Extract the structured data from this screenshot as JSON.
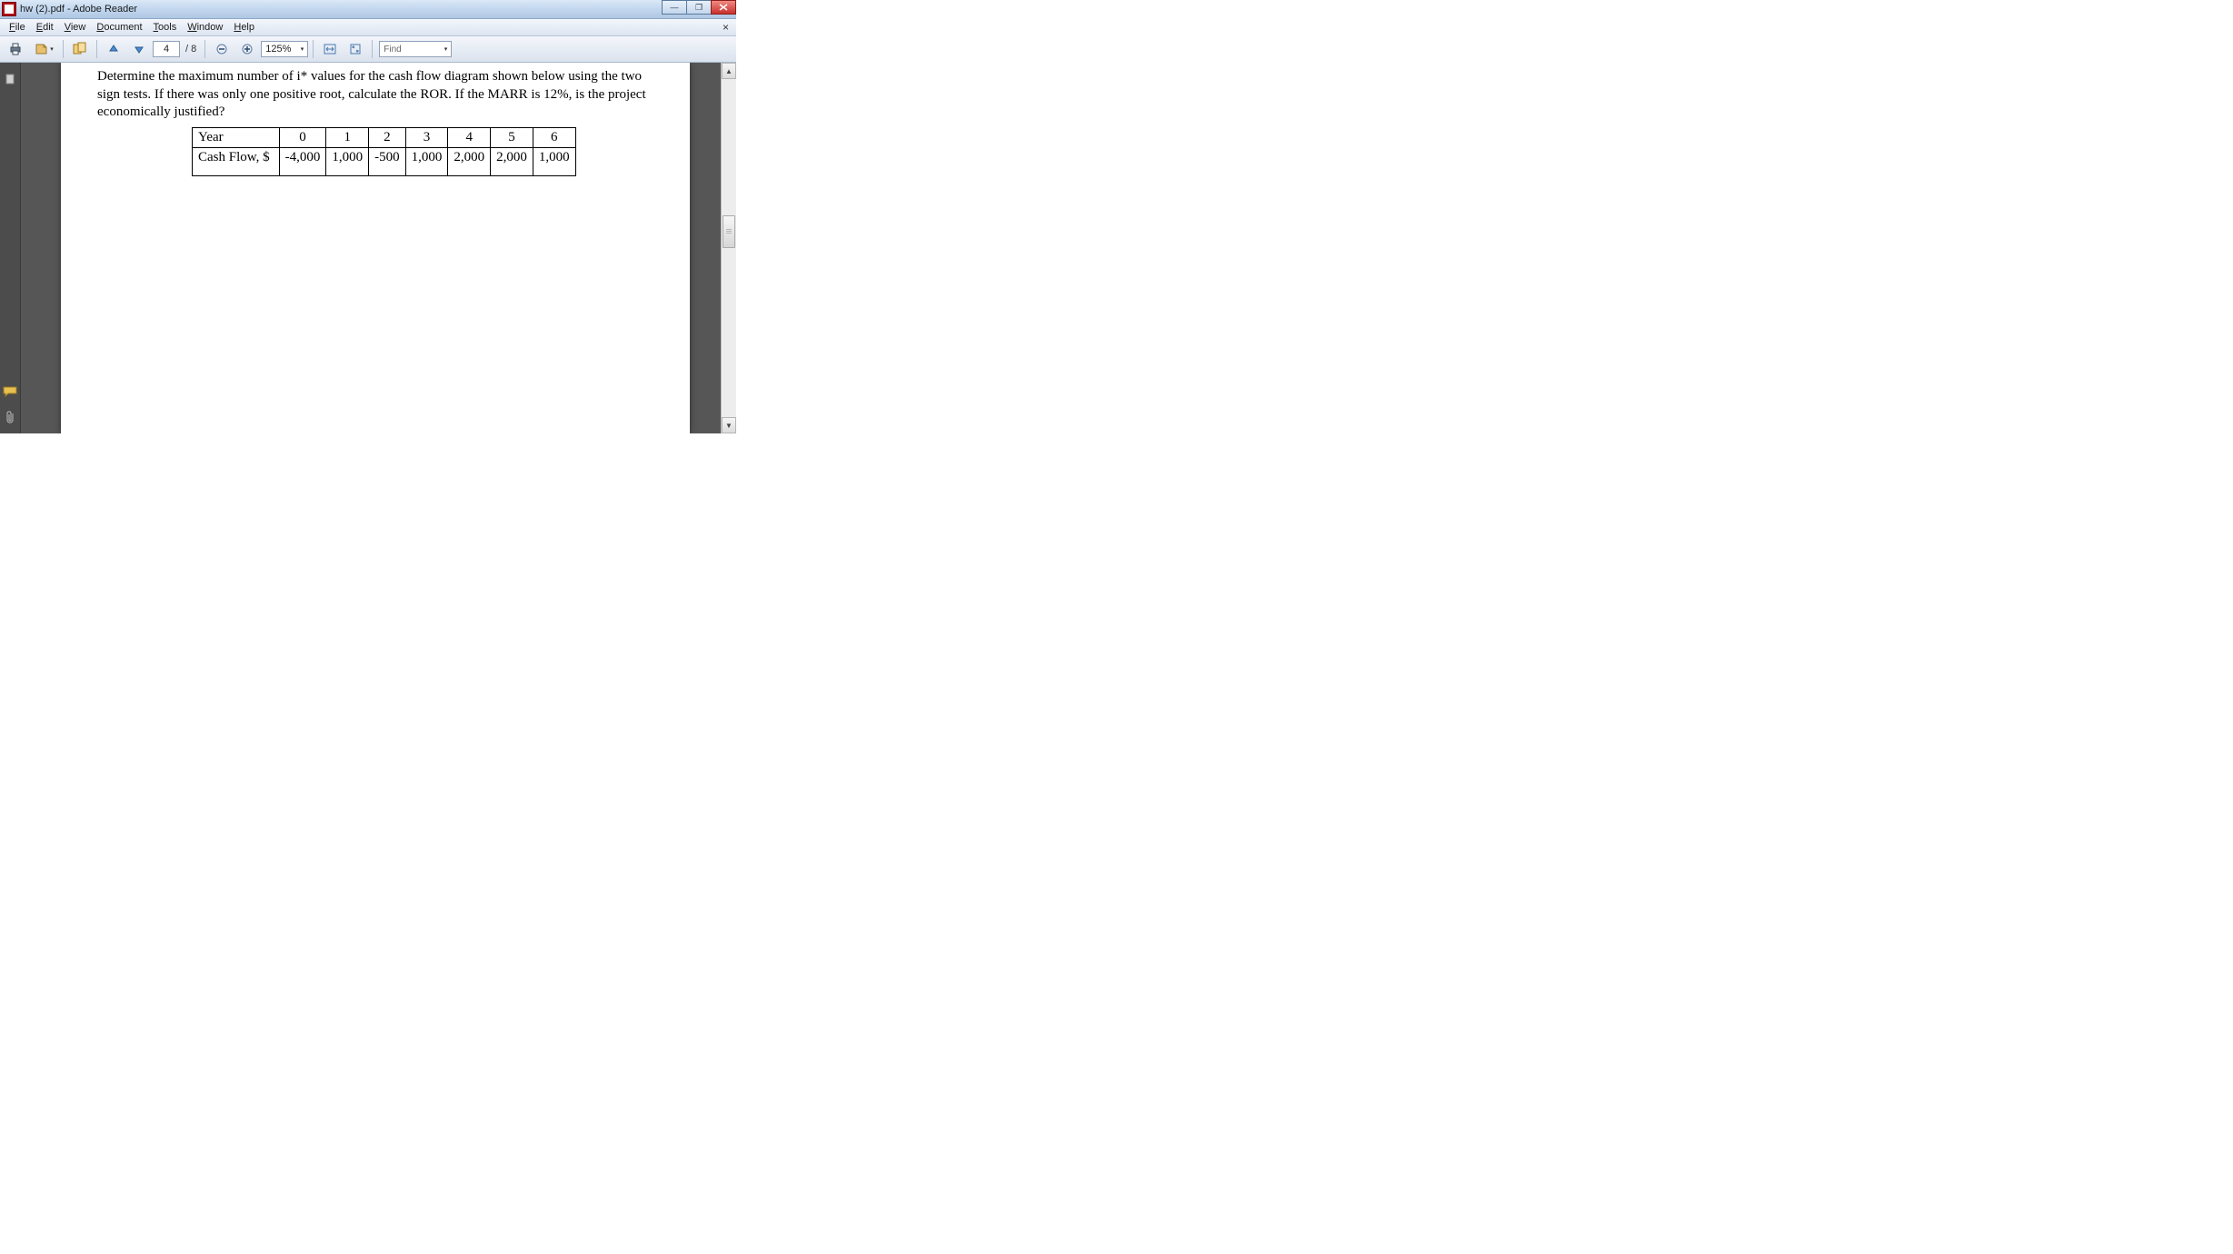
{
  "window": {
    "title": "hw (2).pdf - Adobe Reader"
  },
  "menu": {
    "file": "File",
    "edit": "Edit",
    "view": "View",
    "document": "Document",
    "tools": "Tools",
    "window": "Window",
    "help": "Help"
  },
  "toolbar": {
    "page_current": "4",
    "page_total": "/ 8",
    "zoom": "125%",
    "find_placeholder": "Find"
  },
  "document": {
    "paragraph": "Determine the maximum number of i* values for the cash flow diagram shown below using the two sign tests. If there was only one positive root, calculate the ROR. If the MARR is 12%, is the project economically justified?",
    "table": {
      "headers": [
        "Year",
        "0",
        "1",
        "2",
        "3",
        "4",
        "5",
        "6"
      ],
      "row_label": "Cash Flow, $",
      "row_values": [
        "-4,000",
        "1,000",
        "-500",
        "1,000",
        "2,000",
        "2,000",
        "1,000"
      ]
    }
  },
  "chart_data": {
    "type": "table",
    "title": "Cash Flow by Year",
    "columns": [
      "Year",
      "Cash Flow, $"
    ],
    "rows": [
      [
        0,
        -4000
      ],
      [
        1,
        1000
      ],
      [
        2,
        -500
      ],
      [
        3,
        1000
      ],
      [
        4,
        2000
      ],
      [
        5,
        2000
      ],
      [
        6,
        1000
      ]
    ]
  }
}
